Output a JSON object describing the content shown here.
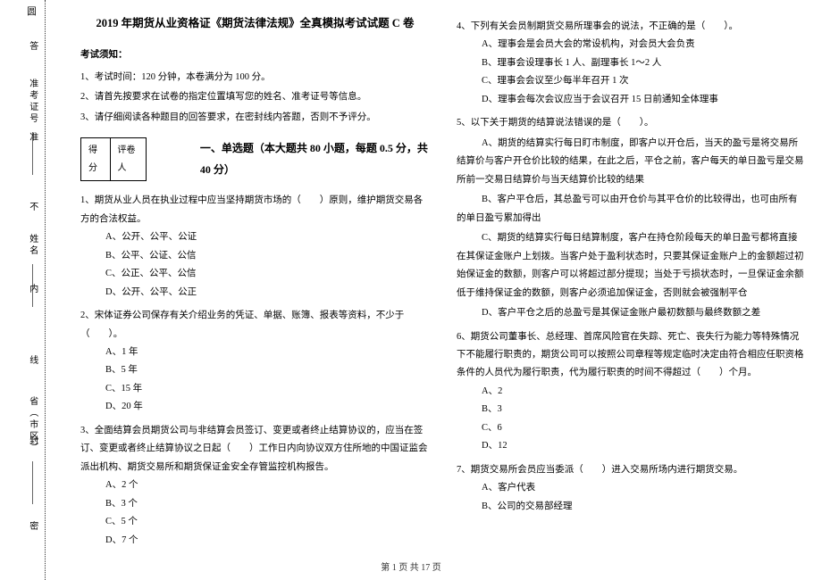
{
  "binding": {
    "char_top": "圆",
    "markers": [
      "答",
      "准",
      "不",
      "内",
      "线",
      "封",
      "密"
    ],
    "fields": {
      "zhunkao": "准考证号",
      "xingming": "姓名",
      "sheng": "省（市区）"
    }
  },
  "doc": {
    "title": "2019 年期货从业资格证《期货法律法规》全真模拟考试试题 C 卷",
    "notice_heading": "考试须知：",
    "notices": {
      "n1": "1、考试时间：120 分钟，本卷满分为 100 分。",
      "n2": "2、请首先按要求在试卷的指定位置填写您的姓名、准考证号等信息。",
      "n3": "3、请仔细阅读各种题目的回答要求，在密封线内答题，否则不予评分。"
    },
    "scorebox": {
      "score": "得分",
      "marker": "评卷人"
    },
    "part1_heading": "一、单选题（本大题共 80 小题，每题 0.5 分，共 40 分）"
  },
  "left_questions": {
    "q1": {
      "stem": "1、期货从业人员在执业过程中应当坚持期货市场的（　　）原则，维护期货交易各方的合法权益。",
      "A": "A、公开、公平、公证",
      "B": "B、公平、公证、公信",
      "C": "C、公正、公平、公信",
      "D": "D、公开、公平、公正"
    },
    "q2": {
      "stem": "2、宋体证券公司保存有关介绍业务的凭证、单据、账簿、报表等资料，不少于（　　）。",
      "A": "A、1 年",
      "B": "B、5 年",
      "C": "C、15 年",
      "D": "D、20 年"
    },
    "q3": {
      "stem": "3、全面结算会员期货公司与非结算会员签订、变更或者终止结算协议的，应当在签订、变更或者终止结算协议之日起（　　）工作日内向协议双方住所地的中国证监会派出机构、期货交易所和期货保证金安全存管监控机构报告。",
      "A": "A、2 个",
      "B": "B、3 个",
      "C": "C、5 个",
      "D": "D、7 个"
    }
  },
  "right_questions": {
    "q4": {
      "stem": "4、下列有关会员制期货交易所理事会的说法，不正确的是（　　）。",
      "A": "A、理事会是会员大会的常设机构，对会员大会负责",
      "B": "B、理事会设理事长 1 人、副理事长 1～2 人",
      "C": "C、理事会会议至少每半年召开 1 次",
      "D": "D、理事会每次会议应当于会议召开 15 日前通知全体理事"
    },
    "q5": {
      "stem": "5、以下关于期货的结算说法错误的是（　　）。",
      "A": "A、期货的结算实行每日盯市制度，即客户以开仓后，当天的盈亏是将交易所结算价与客户开仓价比较的结果，在此之后，平仓之前，客户每天的单日盈亏是交易所前一交易日结算价与当天结算价比较的结果",
      "B": "B、客户平仓后，其总盈亏可以由开仓价与其平仓价的比较得出，也可由所有的单日盈亏累加得出",
      "C": "C、期货的结算实行每日结算制度，客户在持仓阶段每天的单日盈亏都将直接在其保证金账户上划拨。当客户处于盈利状态时，只要其保证金账户上的金额超过初始保证金的数额，则客户可以将超过部分提现；当处于亏损状态时，一旦保证金余额低于维持保证金的数额，则客户必须追加保证金，否则就会被强制平仓",
      "D": "D、客户平仓之后的总盈亏是其保证金账户最初数额与最终数额之差"
    },
    "q6": {
      "stem": "6、期货公司董事长、总经理、首席风险官在失踪、死亡、丧失行为能力等特殊情况下不能履行职责的，期货公司可以按照公司章程等规定临时决定由符合相应任职资格条件的人员代为履行职责，代为履行职责的时间不得超过（　　）个月。",
      "A": "A、2",
      "B": "B、3",
      "C": "C、6",
      "D": "D、12"
    },
    "q7": {
      "stem": "7、期货交易所会员应当委派（　　）进入交易所场内进行期货交易。",
      "A": "A、客户代表",
      "B": "B、公司的交易部经理"
    }
  },
  "footer": "第 1 页 共 17 页"
}
